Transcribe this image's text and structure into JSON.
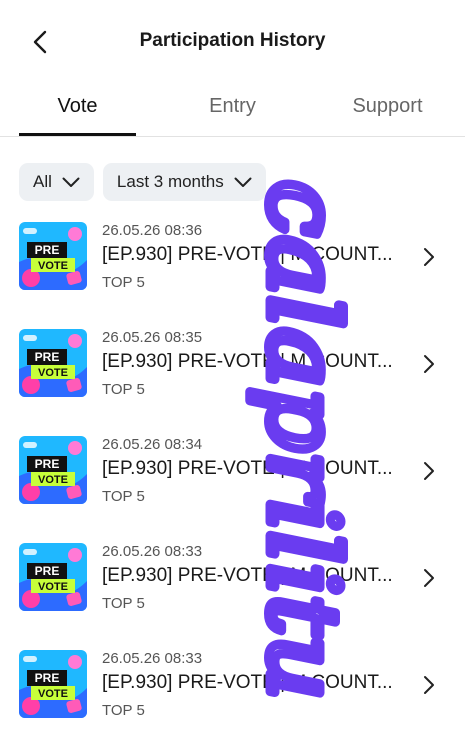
{
  "header": {
    "title": "Participation History",
    "back_icon": "chevron-left-icon"
  },
  "tabs": [
    {
      "label": "Vote",
      "active": true
    },
    {
      "label": "Entry",
      "active": false
    },
    {
      "label": "Support",
      "active": false
    }
  ],
  "filters": [
    {
      "label": "All"
    },
    {
      "label": "Last 3 months"
    }
  ],
  "items": [
    {
      "date": "26.05.26 08:36",
      "title": "[EP.930] PRE-VOTE | M COUNT...",
      "rank": "TOP 5",
      "thumb_text_1": "PRE",
      "thumb_text_2": "VOTE"
    },
    {
      "date": "26.05.26 08:35",
      "title": "[EP.930] PRE-VOTE | M COUNT...",
      "rank": "TOP 5",
      "thumb_text_1": "PRE",
      "thumb_text_2": "VOTE"
    },
    {
      "date": "26.05.26 08:34",
      "title": "[EP.930] PRE-VOTE | M COUNT...",
      "rank": "TOP 5",
      "thumb_text_1": "PRE",
      "thumb_text_2": "VOTE"
    },
    {
      "date": "26.05.26 08:33",
      "title": "[EP.930] PRE-VOTE | M COUNT...",
      "rank": "TOP 5",
      "thumb_text_1": "PRE",
      "thumb_text_2": "VOTE"
    },
    {
      "date": "26.05.26 08:33",
      "title": "[EP.930] PRE-VOTE | M COUNT...",
      "rank": "TOP 5",
      "thumb_text_1": "PRE",
      "thumb_text_2": "VOTE"
    }
  ],
  "watermark": {
    "text": "calaprilitu",
    "color": "#6a3cf0"
  }
}
